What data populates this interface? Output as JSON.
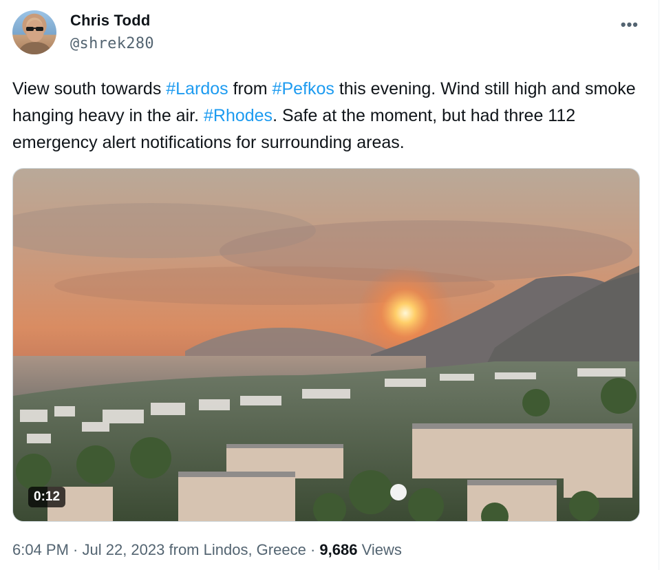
{
  "author": {
    "name": "Chris Todd",
    "handle": "@shrek280",
    "avatar_icon": "profile-photo"
  },
  "more_icon": "more-dots-icon",
  "more_label": "•••",
  "tweet": {
    "segments": [
      {
        "text": "View south towards ",
        "type": "text"
      },
      {
        "text": "#Lardos",
        "type": "hashtag"
      },
      {
        "text": " from ",
        "type": "text"
      },
      {
        "text": "#Pefkos",
        "type": "hashtag"
      },
      {
        "text": " this evening. Wind still high and smoke hanging heavy in the air. ",
        "type": "text"
      },
      {
        "text": "#Rhodes",
        "type": "hashtag"
      },
      {
        "text": ". Safe at the moment, but had three 112 emergency alert notifications for surrounding areas.",
        "type": "text"
      }
    ]
  },
  "media": {
    "type": "video",
    "duration": "0:12",
    "description_icon": "video-thumbnail"
  },
  "meta": {
    "time": "6:04 PM",
    "date": "Jul 22, 2023",
    "location_prefix": "from ",
    "location": "Lindos, Greece",
    "views_count": "9,686",
    "views_label": "Views",
    "separator": " · "
  },
  "colors": {
    "hashtag": "#1d9bf0",
    "secondary_text": "#536471",
    "primary_text": "#0f1419"
  }
}
